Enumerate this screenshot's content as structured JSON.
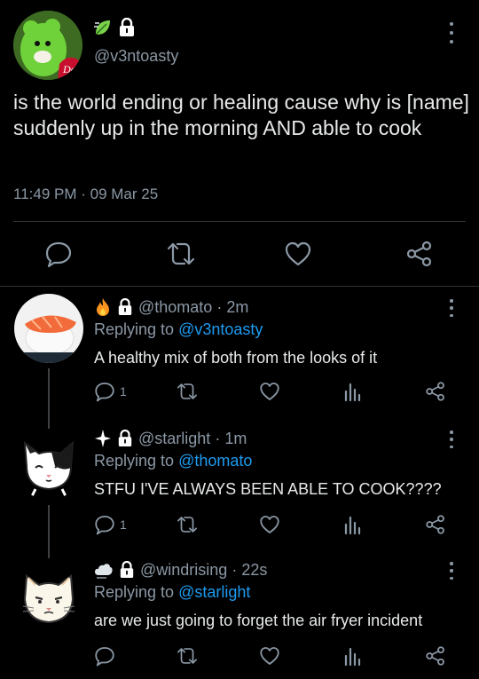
{
  "main_tweet": {
    "handle": "@v3ntoasty",
    "text": "is the world ending or healing cause why is [name] suddenly up in the morning AND able to cook",
    "timestamp": "11:49 PM · 09 Mar 25",
    "badge_icons": [
      "leaf-icon",
      "lock-icon"
    ]
  },
  "replies": [
    {
      "handle": "@thomato",
      "time_sep": " · ",
      "time": "2m",
      "replying_prefix": "Replying to ",
      "replying_to": "@v3ntoasty",
      "text": "A healthy mix of both from the looks of it",
      "reply_count": "1",
      "badge_icons": [
        "fire-icon",
        "lock-icon"
      ]
    },
    {
      "handle": "@starlight",
      "time_sep": " · ",
      "time": "1m",
      "replying_prefix": "Replying to ",
      "replying_to": "@thomato",
      "text": "STFU I'VE ALWAYS BEEN ABLE TO COOK????",
      "reply_count": "1",
      "badge_icons": [
        "sparkle-icon",
        "lock-icon"
      ]
    },
    {
      "handle": "@windrising",
      "time_sep": " · ",
      "time": "22s",
      "replying_prefix": "Replying to ",
      "replying_to": "@starlight",
      "text": "are we just going to forget the air fryer incident",
      "reply_count": "",
      "badge_icons": [
        "cloud-wind-icon",
        "lock-icon"
      ]
    }
  ],
  "colors": {
    "background": "#000000",
    "text": "#e7e9ea",
    "muted": "#8b98a5",
    "mention": "#1d9bf0",
    "divider": "#2f3336"
  }
}
